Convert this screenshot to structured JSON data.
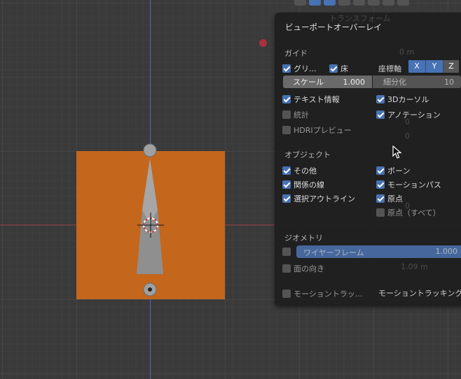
{
  "panel": {
    "title": "ビューポートオーバーレイ",
    "guides": {
      "heading": "ガイド",
      "grid_label": "グリ...",
      "floor_label": "床",
      "axes_label": "座標軸",
      "axes": [
        "X",
        "Y",
        "Z"
      ],
      "scale_label": "スケール",
      "scale_value": "1.000",
      "subdiv_label": "細分化",
      "subdiv_value": "10",
      "text_info": "テキスト情報",
      "cursor_3d": "3Dカーソル",
      "stats": "統計",
      "annotations": "アノテーション",
      "hdri_preview": "HDRIプレビュー"
    },
    "objects": {
      "heading": "オブジェクト",
      "extras": "その他",
      "bones": "ボーン",
      "relationship_lines": "関係の線",
      "motion_paths": "モーションパス",
      "outline_selected": "選択アウトライン",
      "origins": "原点",
      "origins_all": "原点（すべて）"
    },
    "geometry": {
      "heading": "ジオメトリ",
      "wireframe_label": "ワイヤーフレーム",
      "wireframe_value": "1.000",
      "face_orientation": "面の向き"
    },
    "motion_tracking_left": "モーショントラッ...",
    "motion_tracking_right": "モーショントラッキング"
  },
  "background_panel": {
    "header": "トランスフォーム",
    "units": [
      "0 m",
      "0 m",
      "1.09 m"
    ],
    "zeros": [
      "0",
      "0",
      "0"
    ]
  },
  "colors": {
    "accent": "#4772b3",
    "plane": "#c4661c",
    "panel_bg": "#1f1f1f"
  }
}
